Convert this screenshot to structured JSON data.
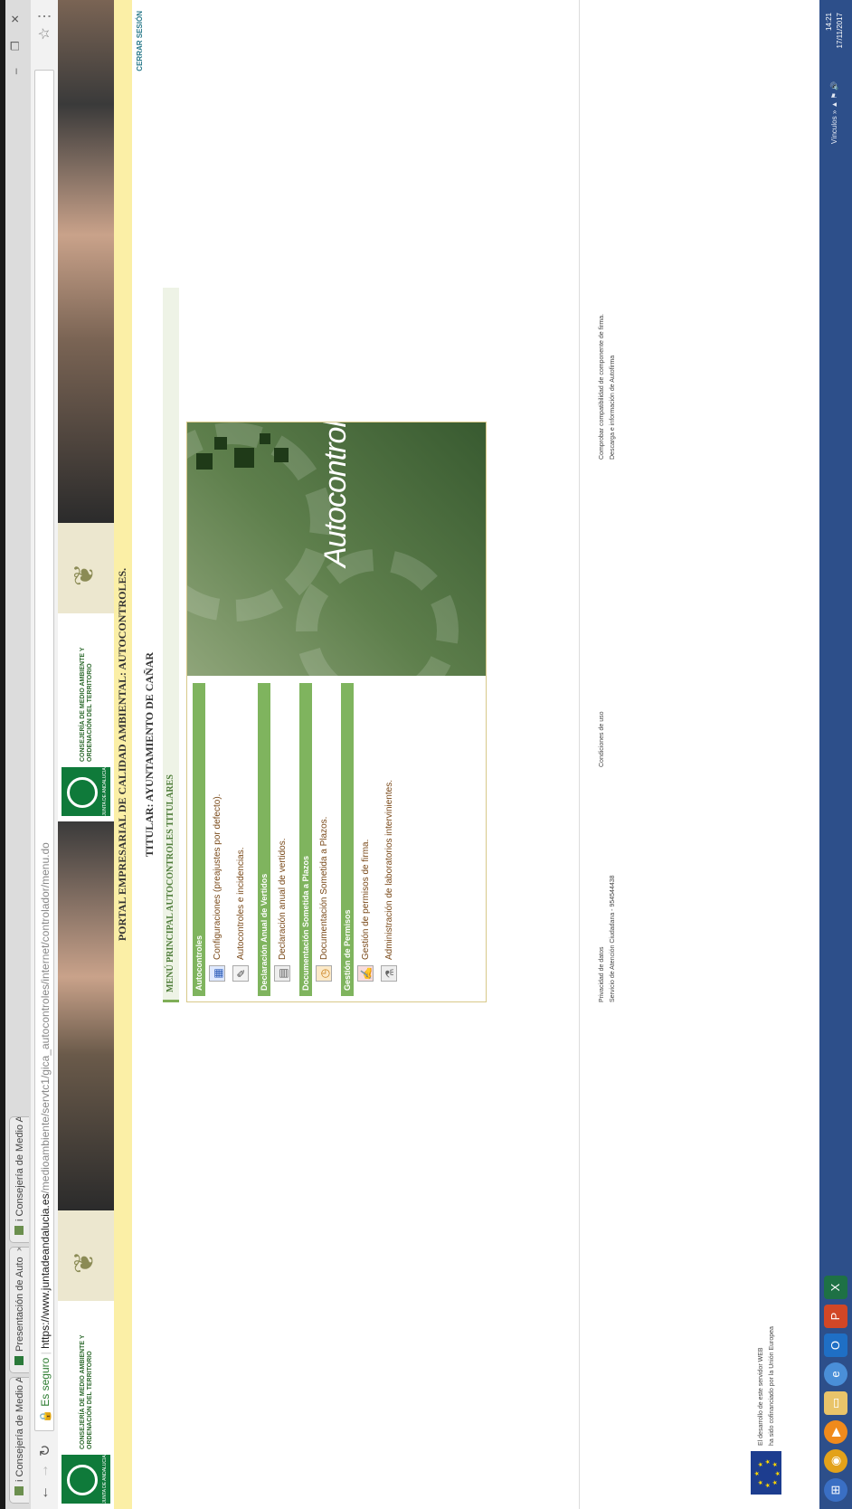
{
  "browser": {
    "tabs": [
      {
        "label": "i Consejería de Medio A"
      },
      {
        "label": "Presentación de Auto"
      },
      {
        "label": "i Consejería de Medio A"
      }
    ],
    "secure_label": "Es seguro",
    "url_main": "https://www.juntadeandalucia.es",
    "url_path": "/medioambiente/servtc1/gica_autocontroles/internet/controlador/menu.do"
  },
  "header": {
    "consejeria": "CONSEJERÍA DE MEDIO AMBIENTE Y ORDENACIÓN DEL TERRITORIO",
    "junta": "JUNTA DE ANDALUCIA"
  },
  "portal_title": "PORTAL EMPRESARIAL DE CALIDAD AMBIENTAL: AUTOCONTROLES.",
  "logout": "CERRAR SESIÓN",
  "titular": "TITULAR: AYUNTAMIENTO DE CAÑAR",
  "menu": {
    "title": "MENÚ PRINCIPAL AUTOCONTROLES TITULARES",
    "sections": [
      {
        "title": "Autocontroles",
        "items": [
          {
            "label": "Configuraciones (preajustes por defecto).",
            "icon": "calendar-icon"
          },
          {
            "label": "Autocontroles e incidencias.",
            "icon": "document-pen-icon"
          }
        ]
      },
      {
        "title": "Declaración Anual de Vertidos",
        "items": [
          {
            "label": "Declaración anual de vertidos.",
            "icon": "form-icon"
          }
        ]
      },
      {
        "title": "Documentación Sometida a Plazos",
        "items": [
          {
            "label": "Documentación Sometida a Plazos.",
            "icon": "clock-document-icon"
          }
        ]
      },
      {
        "title": "Gestión de Permisos",
        "items": [
          {
            "label": "Gestión de permisos de firma.",
            "icon": "signature-icon"
          },
          {
            "label": "Administración de laboratorios intervinientes.",
            "icon": "laboratory-icon"
          }
        ]
      }
    ],
    "hero_text": "Autocontroles"
  },
  "footer": {
    "privacy": "Privacidad de datos",
    "service": "Servicio de Atención Ciudadana - 954544438",
    "conditions": "Condiciones de uso",
    "compat": "Comprobar compatibilidad de componente de firma.",
    "download": "Descarga e información de Autofirma",
    "eu_line1": "El desarrollo de este servidor WEB",
    "eu_line2": "ha sido cofinanciado por la Unión Europea"
  },
  "taskbar": {
    "time": "14:21",
    "date": "17/11/2017",
    "tray": "Vínculos"
  },
  "colors": {
    "section_header": "#7fb45e",
    "link_text": "#7a4a1a",
    "yellow_bar": "#fbefa6",
    "header_band": "#a9b35d"
  }
}
